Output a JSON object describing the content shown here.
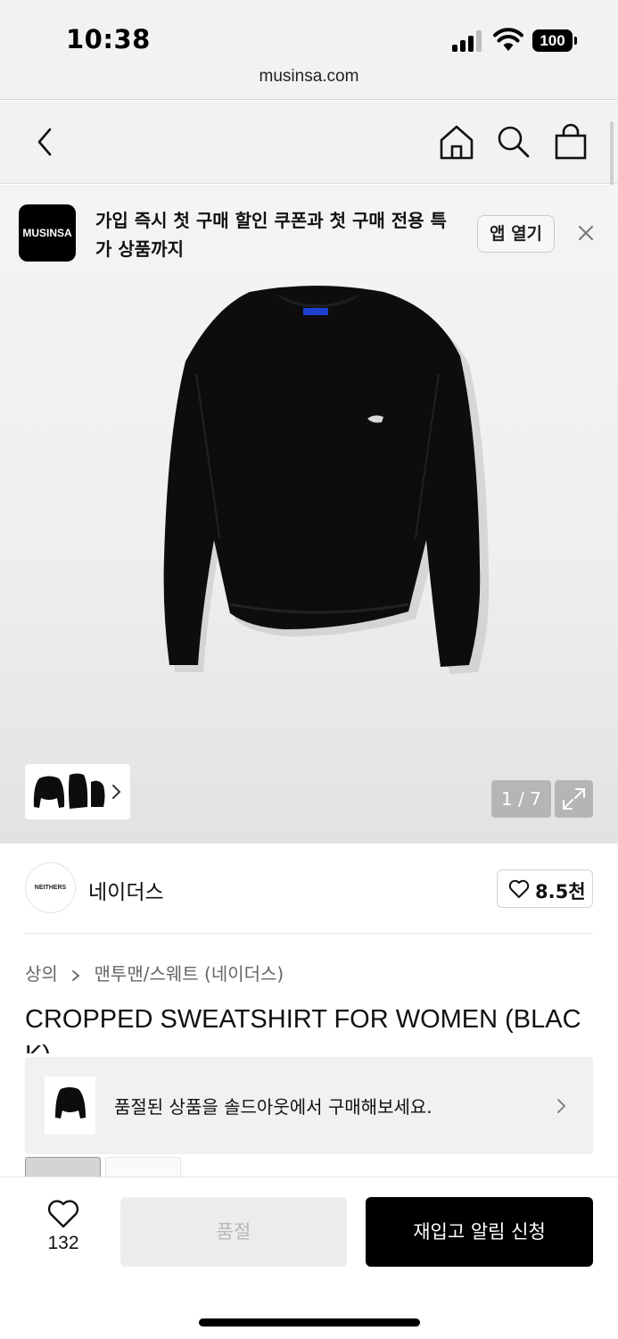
{
  "status_bar": {
    "time": "10:38",
    "battery": "100",
    "url": "musinsa.com"
  },
  "nav": {
    "icons": [
      "back-icon",
      "home-icon",
      "search-icon",
      "shopping-bag-icon"
    ]
  },
  "app_banner": {
    "logo_text": "MUSINSA",
    "message": "가입 즉시 첫 구매 할인 쿠폰과 첫 구매 전용 특가 상품까지",
    "open_label": "앱 열기"
  },
  "gallery": {
    "page_counter": "1 / 7"
  },
  "brand": {
    "logo_text": "NEITHERS",
    "name": "네이더스",
    "likes": "8.5천"
  },
  "breadcrumb": {
    "category": "상의",
    "subcategory": "맨투맨/스웨트 (네이더스)"
  },
  "product": {
    "title": "CROPPED SWEATSHIRT FOR WOMEN (BLACK)"
  },
  "soldout_banner": {
    "text": "품절된 상품을 솔드아웃에서 구매해보세요."
  },
  "bottom_bar": {
    "like_count": "132",
    "soldout_label": "품절",
    "restock_label": "재입고 알림 신청"
  },
  "colors": {
    "accent": "#000000",
    "surface": "#f2f2f2",
    "muted": "#b9b9b9"
  }
}
